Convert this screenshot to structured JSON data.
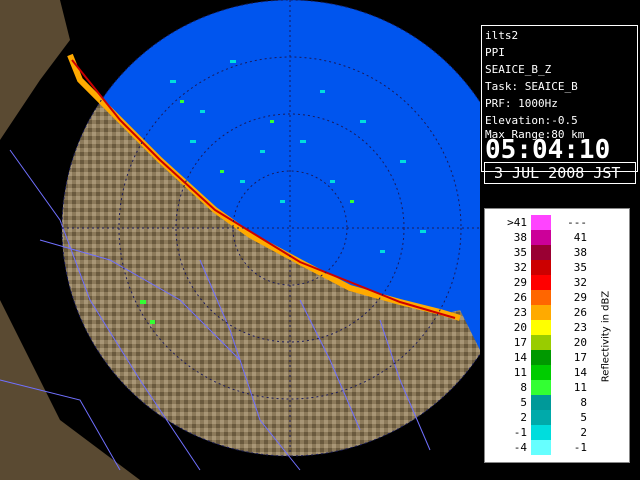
{
  "info": {
    "station": "ilts2",
    "product": "PPI",
    "product_name": "SEAICE_B_Z",
    "task": "Task: SEAICE_B",
    "prf": "PRF: 1000Hz",
    "elevation": "Elevation:-0.5",
    "max_range": "Max Range:80 km",
    "time": "05:04:10",
    "date": "3 JUL 2008 JST"
  },
  "legend": {
    "unit_label": "Reflectivity in dBZ",
    "rows": [
      {
        "lo": ">41",
        "hi": "---",
        "color": "#ff44ff"
      },
      {
        "lo": "38",
        "hi": "41",
        "color": "#cc0099"
      },
      {
        "lo": "35",
        "hi": "38",
        "color": "#990033"
      },
      {
        "lo": "32",
        "hi": "35",
        "color": "#cc0000"
      },
      {
        "lo": "29",
        "hi": "32",
        "color": "#ff0000"
      },
      {
        "lo": "26",
        "hi": "29",
        "color": "#ff6600"
      },
      {
        "lo": "23",
        "hi": "26",
        "color": "#ffaa00"
      },
      {
        "lo": "20",
        "hi": "23",
        "color": "#ffff00"
      },
      {
        "lo": "17",
        "hi": "20",
        "color": "#99cc00"
      },
      {
        "lo": "14",
        "hi": "17",
        "color": "#009900"
      },
      {
        "lo": "11",
        "hi": "14",
        "color": "#00cc00"
      },
      {
        "lo": "8",
        "hi": "11",
        "color": "#33ff33"
      },
      {
        "lo": "5",
        "hi": "8",
        "color": "#009999"
      },
      {
        "lo": "2",
        "hi": "5",
        "color": "#00aaaa"
      },
      {
        "lo": "-1",
        "hi": "2",
        "color": "#00dddd"
      },
      {
        "lo": "-4",
        "hi": "-1",
        "color": "#66ffff"
      }
    ]
  },
  "colors": {
    "sea": "#0055ee",
    "land_light": "#9c8a6a",
    "land_dark": "#5a4a32",
    "rivers": "#7070ff",
    "range_rings": "#1a1a5a"
  }
}
